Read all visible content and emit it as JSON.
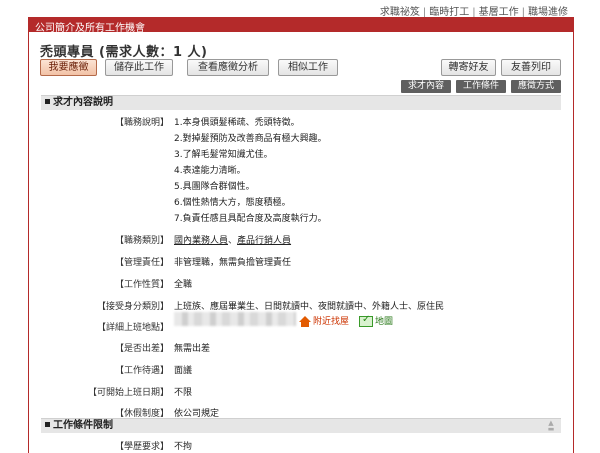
{
  "top_nav": {
    "items": [
      "求職祕笈",
      "臨時打工",
      "基層工作",
      "職場進修"
    ],
    "separator": "|"
  },
  "company_link": "公司簡介及所有工作機會",
  "job": {
    "title": "禿頭專員 (需求人數：1 人)"
  },
  "buttons": {
    "apply": "我要應徵",
    "save": "儲存此工作",
    "analysis": "查看應徵分析",
    "similar": "相似工作",
    "forward": "轉寄好友",
    "print": "友善列印"
  },
  "tabs": [
    "求才內容",
    "工作條件",
    "應徵方式"
  ],
  "sections": {
    "content": "求才內容說明",
    "conditions": "工作條件限制"
  },
  "details": {
    "description_label": "【職務說明】",
    "description_lines": [
      "1.本身俱頭髮稀疏、禿頭特徵。",
      "2.對掉髮預防及改善商品有極大興趣。",
      "3.了解毛髮常知識尤佳。",
      "4.表達能力清晰。",
      "5.具團隊合群個性。",
      "6.個性熱情大方，態度積極。",
      "7.負責任感且具配合度及高度執行力。"
    ],
    "category_label": "【職務類別】",
    "category_values": [
      "國內業務人員",
      "產品行銷人員"
    ],
    "category_sep": "、",
    "management_label": "【管理責任】",
    "management_value": "非管理職，無需負擔管理責任",
    "nature_label": "【工作性質】",
    "nature_value": "全職",
    "identity_label": "【接受身分類別】",
    "identity_value": "上班族、應屆畢業生、日間就讀中、夜間就讀中、外籍人士、原住民",
    "location_label": "【詳細上班地點】",
    "nearby_link": "附近找屋",
    "map_link": "地圖",
    "travel_label": "【是否出差】",
    "travel_value": "無需出差",
    "salary_label": "【工作待遇】",
    "salary_value": "面議",
    "start_label": "【可開始上班日期】",
    "start_value": "不限",
    "vacation_label": "【休假制度】",
    "vacation_value": "依公司規定",
    "education_label": "【學歷要求】",
    "education_value": "不拘"
  },
  "colors": {
    "brand_red": "#b42a2a",
    "section_bg": "#e6e6e6",
    "tab_bg": "#5f5f5f"
  }
}
